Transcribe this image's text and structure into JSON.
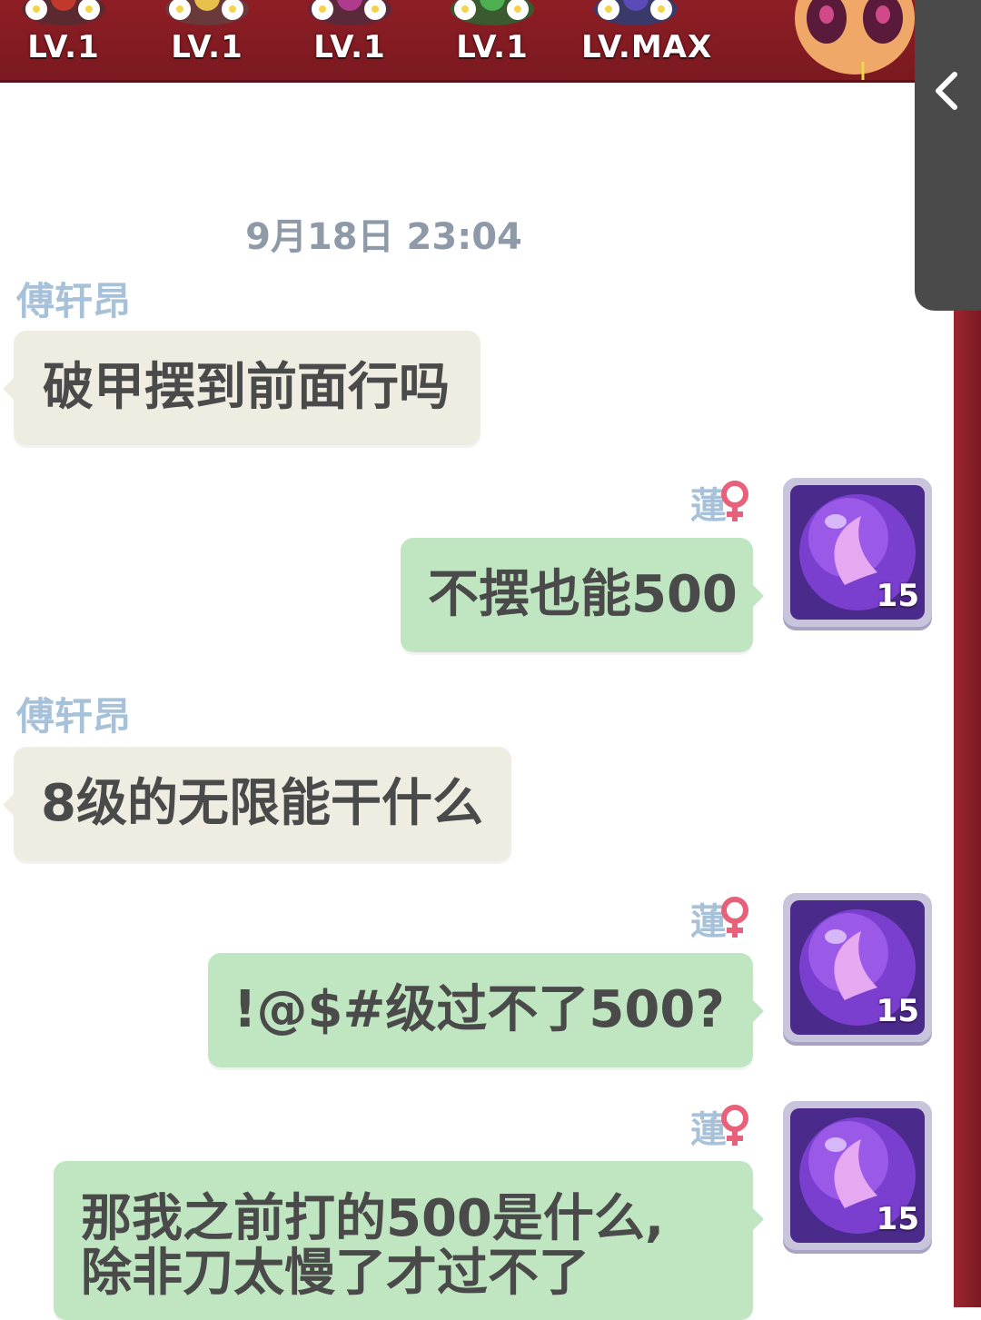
{
  "banner": {
    "levels": [
      "LV.1",
      "LV.1",
      "LV.1",
      "LV.1",
      "LV.MAX"
    ]
  },
  "chat": {
    "timestamp": "9月18日 23:04",
    "messages": [
      {
        "sender": "傅轩昂",
        "text": "破甲摆到前面行吗",
        "side": "left"
      },
      {
        "sender": "蓮",
        "text": "不摆也能500",
        "side": "right",
        "badge": "15"
      },
      {
        "sender": "傅轩昂",
        "text": "8级的无限能干什么",
        "side": "left"
      },
      {
        "sender": "蓮",
        "text": "!@$#级过不了500?",
        "side": "right",
        "badge": "15"
      },
      {
        "sender": "蓮",
        "text_line1": "那我之前打的500是什么,",
        "text_line2": "除非刀太慢了才过不了",
        "side": "right",
        "badge": "15"
      }
    ]
  },
  "icons": {
    "collapse": "chevron-left-icon",
    "gender": "female-icon",
    "avatar": "butterfly-orb-icon"
  },
  "colors": {
    "banner": "#8e1e25",
    "bubble_left": "#efede2",
    "bubble_right": "#bfe6c0",
    "sender_name": "#a7c2d8",
    "female": "#e8607a"
  }
}
